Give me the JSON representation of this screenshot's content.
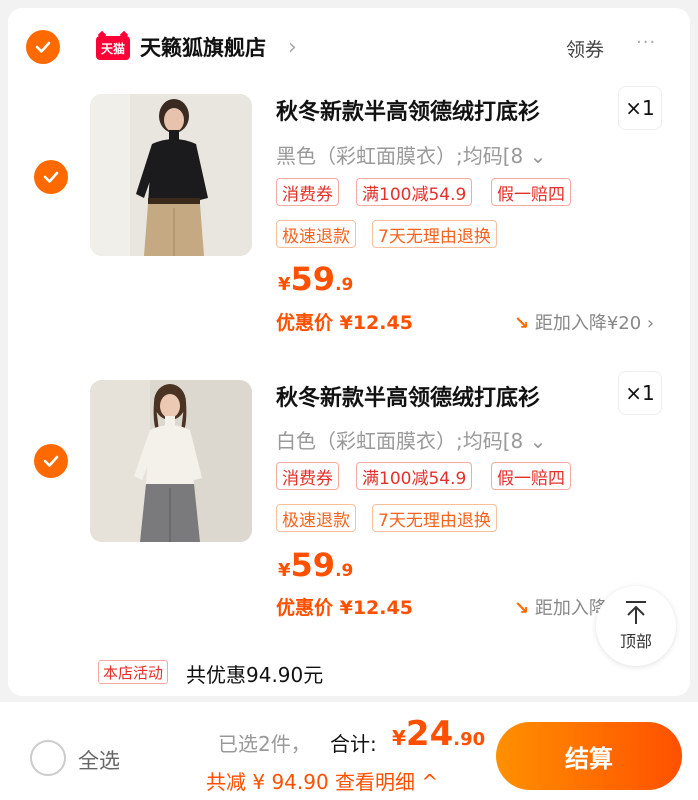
{
  "shop": {
    "badge": "天猫",
    "name": "天籁狐旗舰店",
    "chevron": "›",
    "coupon_label": "领券",
    "more": "···"
  },
  "items": [
    {
      "title": "秋冬新款半高领德绒打底衫",
      "quantity": "×1",
      "sku": "黑色（彩虹面膜衣）;均码[8 ⌄",
      "tags": [
        "消费券",
        "满100减54.9",
        "假一赔四",
        "极速退款",
        "7天无理由退换"
      ],
      "price_currency": "¥",
      "price_int": "59",
      "price_dec": ".9",
      "deal_price": "优惠价 ¥12.45",
      "drop_arrow": "↘",
      "drop_text": "距加入降¥20",
      "drop_chevron": "›"
    },
    {
      "title": "秋冬新款半高领德绒打底衫",
      "quantity": "×1",
      "sku": "白色（彩虹面膜衣）;均码[8 ⌄",
      "tags": [
        "消费券",
        "满100减54.9",
        "假一赔四",
        "极速退款",
        "7天无理由退换"
      ],
      "price_currency": "¥",
      "price_int": "59",
      "price_dec": ".9",
      "deal_price": "优惠价 ¥12.45",
      "drop_arrow": "↘",
      "drop_text": "距加入降"
    }
  ],
  "store_promo": {
    "tag": "本店活动",
    "summary": "共优惠94.90元"
  },
  "back_to_top": {
    "label": "顶部"
  },
  "footer": {
    "select_all": "全选",
    "selected_count": "已选2件，",
    "total_label": "合计:",
    "total_currency": "¥",
    "total_int": "24",
    "total_dec": ".90",
    "saved": "共减 ¥ 94.90  查看明细 ^",
    "checkout": "结算"
  },
  "colors": {
    "accent": "#ff5000",
    "check": "#ff6a00",
    "tag_red": "#e3302b",
    "tmall_red": "#ff0036"
  }
}
